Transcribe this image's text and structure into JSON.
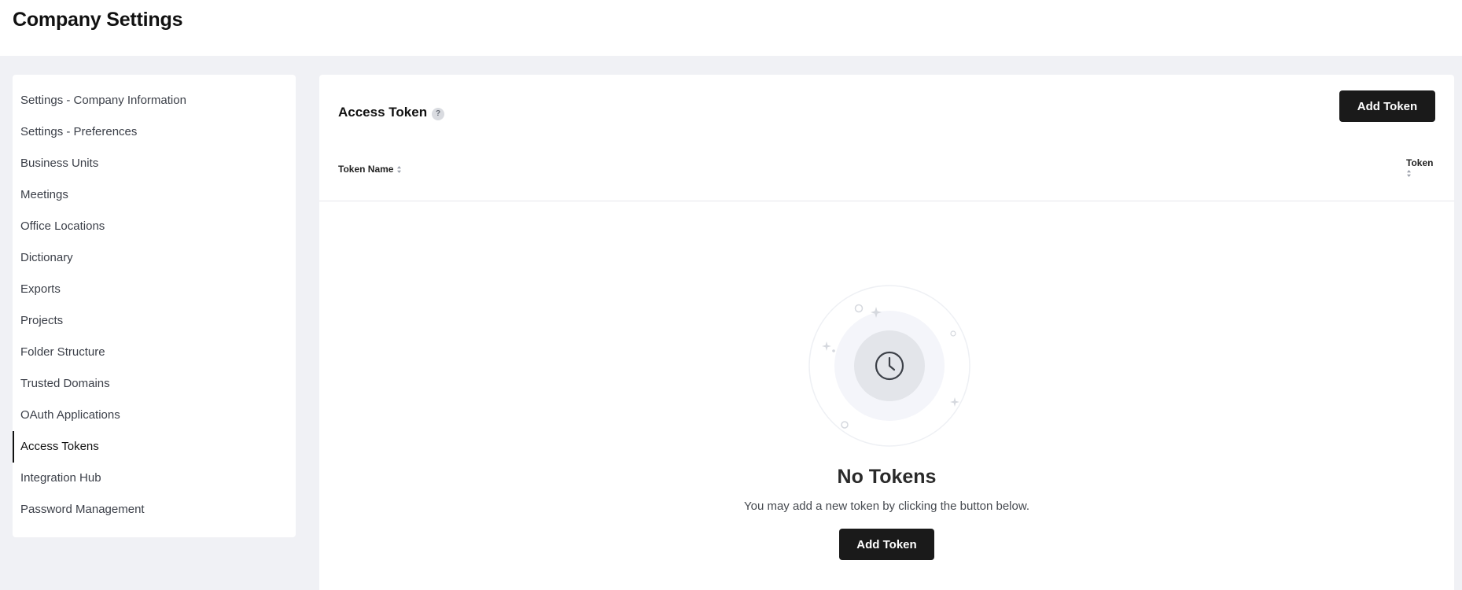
{
  "header": {
    "title": "Company Settings"
  },
  "sidebar": {
    "items": [
      {
        "label": "Settings - Company Information",
        "active": false
      },
      {
        "label": "Settings - Preferences",
        "active": false
      },
      {
        "label": "Business Units",
        "active": false
      },
      {
        "label": "Meetings",
        "active": false
      },
      {
        "label": "Office Locations",
        "active": false
      },
      {
        "label": "Dictionary",
        "active": false
      },
      {
        "label": "Exports",
        "active": false
      },
      {
        "label": "Projects",
        "active": false
      },
      {
        "label": "Folder Structure",
        "active": false
      },
      {
        "label": "Trusted Domains",
        "active": false
      },
      {
        "label": "OAuth Applications",
        "active": false
      },
      {
        "label": "Access Tokens",
        "active": true
      },
      {
        "label": "Integration Hub",
        "active": false
      },
      {
        "label": "Password Management",
        "active": false
      }
    ]
  },
  "main": {
    "section_title": "Access Token",
    "help_icon": "help-icon",
    "help_glyph": "?",
    "add_token_label": "Add Token",
    "table": {
      "columns": [
        "Token Name",
        "Token"
      ],
      "sort_icon": "sort-icon"
    },
    "empty_state": {
      "icon": "clock-icon",
      "title": "No Tokens",
      "description": "You may add a new token by clicking the button below.",
      "button_label": "Add Token"
    }
  },
  "colors": {
    "background": "#f0f1f5",
    "surface": "#ffffff",
    "primary_button": "#1a1a1a",
    "divider": "#e6e7eb"
  }
}
